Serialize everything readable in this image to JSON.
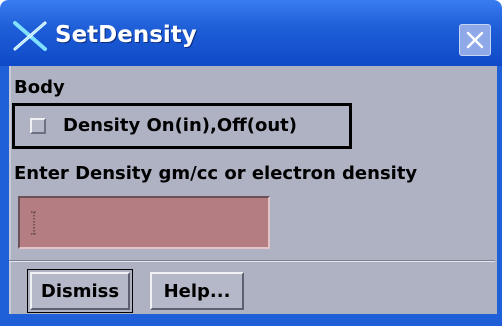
{
  "window": {
    "title": "SetDensity",
    "icon": "x-app-icon",
    "close_icon": "close-icon"
  },
  "body": {
    "section_label": "Body",
    "density_toggle": {
      "label": "Density On(in),Off(out)",
      "checked": false
    },
    "density_prompt": "Enter Density gm/cc or electron density",
    "density_input": {
      "value": ""
    }
  },
  "buttons": {
    "dismiss": "Dismiss",
    "help": "Help..."
  },
  "colors": {
    "titlebar": "#1f5fd8",
    "client_bg": "#aeb2c3",
    "entry_bg": "#b37d82"
  }
}
